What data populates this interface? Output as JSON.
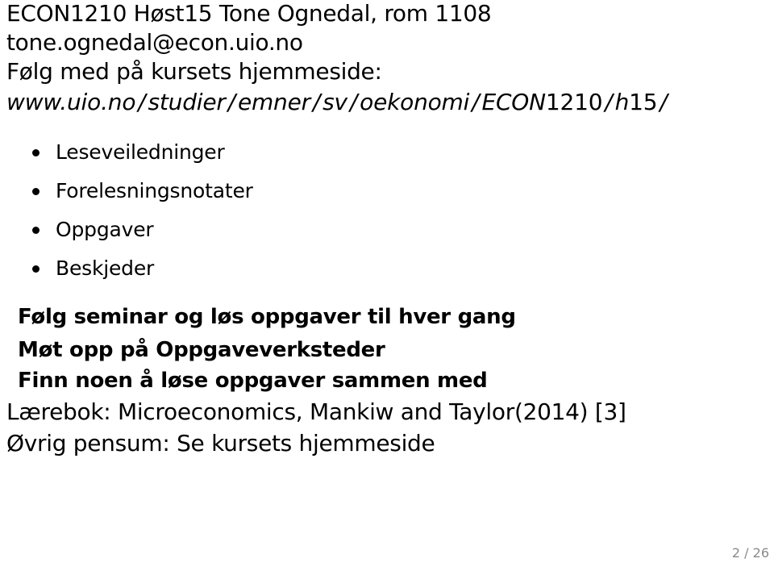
{
  "header": {
    "title": "ECON1210 Høst15 Tone Ognedal, rom 1108",
    "email": "tone.ognedal@econ.uio.no",
    "follow_text": "Følg med på kursets hjemmeside:",
    "url_parts": {
      "host": "www.uio.no",
      "p1": "studier",
      "p2": "emner",
      "p3": "sv",
      "p4": "oekonomi",
      "p5_italic": "ECON",
      "p5_upright": "1210",
      "p6_italic": "h",
      "p6_upright": "15",
      "slash": "/"
    }
  },
  "bullets": [
    {
      "label": "Leseveiledninger"
    },
    {
      "label": "Forelesningsnotater"
    },
    {
      "label": "Oppgaver"
    },
    {
      "label": "Beskjeder"
    }
  ],
  "emphasis": [
    "Følg seminar og løs oppgaver til hver gang",
    "Møt opp på Oppgaveverksteder",
    "Finn noen å løse oppgaver sammen med"
  ],
  "textbook": "Lærebok: Microeconomics, Mankiw and Taylor(2014) [3]",
  "other_curriculum": "Øvrig pensum: Se kursets hjemmeside",
  "page": {
    "current": "2",
    "total": "26",
    "separator": " / "
  }
}
